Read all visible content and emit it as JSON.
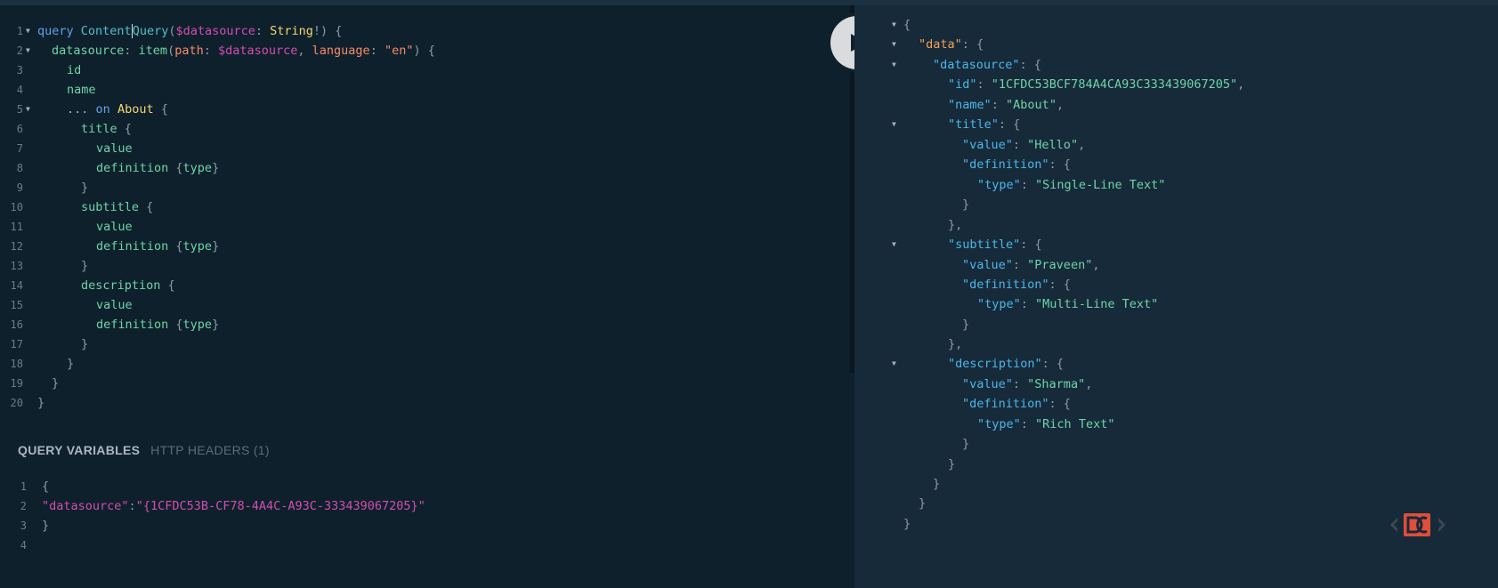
{
  "query_editor": {
    "lines": [
      {
        "n": "1",
        "fold": true
      },
      {
        "n": "2",
        "fold": true
      },
      {
        "n": "3",
        "fold": false
      },
      {
        "n": "4",
        "fold": false
      },
      {
        "n": "5",
        "fold": true
      },
      {
        "n": "6",
        "fold": false
      },
      {
        "n": "7",
        "fold": false
      },
      {
        "n": "8",
        "fold": false
      },
      {
        "n": "9",
        "fold": false
      },
      {
        "n": "10",
        "fold": false
      },
      {
        "n": "11",
        "fold": false
      },
      {
        "n": "12",
        "fold": false
      },
      {
        "n": "13",
        "fold": false
      },
      {
        "n": "14",
        "fold": false
      },
      {
        "n": "15",
        "fold": false
      },
      {
        "n": "16",
        "fold": false
      },
      {
        "n": "17",
        "fold": false
      },
      {
        "n": "18",
        "fold": false
      },
      {
        "n": "19",
        "fold": false
      },
      {
        "n": "20",
        "fold": false
      }
    ],
    "tokens": {
      "query_kw": "query",
      "op_name_a": "Content",
      "op_name_b": "Query",
      "datasource_var": "$datasource",
      "string_type": "String",
      "datasource_field": "datasource",
      "item_field": "item",
      "path_arg": "path",
      "language_arg": "language",
      "lang_value": "\"en\"",
      "id_field": "id",
      "name_field": "name",
      "spread": "...",
      "on_kw": "on",
      "about_type": "About",
      "title_field": "title",
      "value_field": "value",
      "definition_field": "definition",
      "type_field": "type",
      "subtitle_field": "subtitle",
      "description_field": "description"
    }
  },
  "variables_panel": {
    "tab_query_variables": "QUERY VARIABLES",
    "tab_http_headers": "HTTP HEADERS (1)",
    "line_numbers": [
      "1",
      "2",
      "3",
      "4"
    ],
    "key": "\"datasource\"",
    "value": "\"{1CFDC53B-CF78-4A4C-A93C-333439067205}\""
  },
  "run_button": {
    "icon": "play-icon"
  },
  "result": {
    "data_key": "\"data\"",
    "datasource_key": "\"datasource\"",
    "id_key": "\"id\"",
    "id_value": "\"1CFDC53BCF784A4CA93C333439067205\"",
    "name_key": "\"name\"",
    "name_value": "\"About\"",
    "title_key": "\"title\"",
    "value_key": "\"value\"",
    "title_value": "\"Hello\"",
    "definition_key": "\"definition\"",
    "type_key": "\"type\"",
    "title_type": "\"Single-Line Text\"",
    "subtitle_key": "\"subtitle\"",
    "subtitle_value": "\"Praveen\"",
    "subtitle_type": "\"Multi-Line Text\"",
    "description_key": "\"description\"",
    "description_value": "\"Sharma\"",
    "description_type": "\"Rich Text\""
  },
  "brand": {
    "logo": "graphql-playground-logo-icon",
    "accent": "#e04e39"
  }
}
